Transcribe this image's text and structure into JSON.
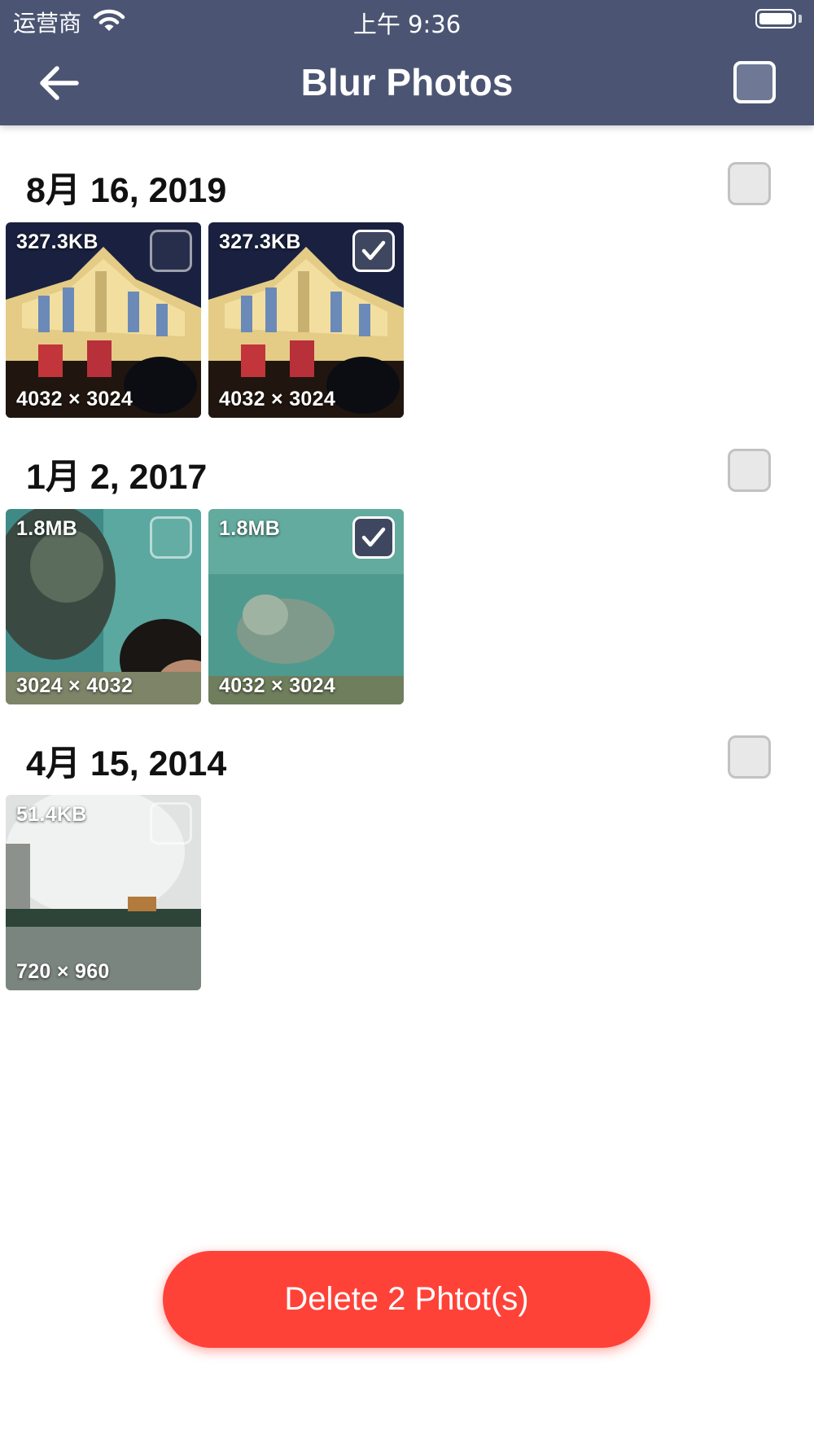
{
  "status_bar": {
    "carrier": "运营商",
    "time": "上午 9:36"
  },
  "nav": {
    "title": "Blur Photos",
    "back_icon": "arrow-left-icon",
    "select_all_checked": false
  },
  "sections": [
    {
      "date": "8月 16, 2019",
      "checked": false,
      "photos": [
        {
          "size": "327.3KB",
          "dimensions": "4032 × 3024",
          "checked": false,
          "scene": "building-night"
        },
        {
          "size": "327.3KB",
          "dimensions": "4032 × 3024",
          "checked": true,
          "scene": "building-night"
        }
      ]
    },
    {
      "date": "1月 2, 2017",
      "checked": false,
      "photos": [
        {
          "size": "1.8MB",
          "dimensions": "3024 × 4032",
          "checked": false,
          "scene": "seal-aquarium-with-person"
        },
        {
          "size": "1.8MB",
          "dimensions": "4032 × 3024",
          "checked": true,
          "scene": "seal-aquarium"
        }
      ]
    },
    {
      "date": "4月 15, 2014",
      "checked": false,
      "photos": [
        {
          "size": "51.4KB",
          "dimensions": "720 × 960",
          "checked": false,
          "scene": "steam-over-water"
        }
      ]
    }
  ],
  "delete_button": {
    "label": "Delete 2 Phtot(s)"
  },
  "colors": {
    "nav_background": "#4b5573",
    "delete_button": "#ff4238",
    "checked_box": "#3f4760"
  }
}
